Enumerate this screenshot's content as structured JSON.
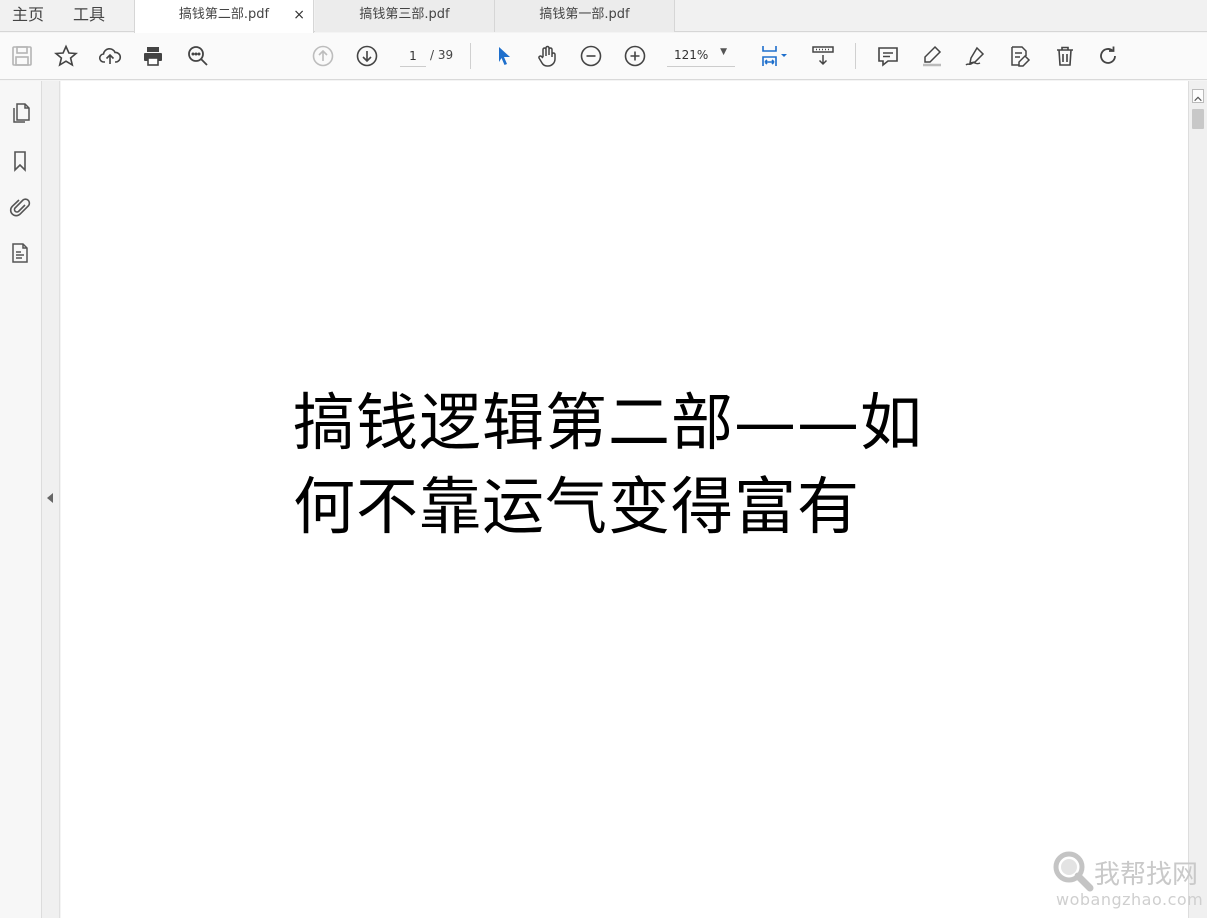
{
  "menu": {
    "home_label": "主页",
    "tools_label": "工具"
  },
  "tabs": [
    {
      "label": "搞钱第二部.pdf",
      "active": true,
      "close": "×"
    },
    {
      "label": "搞钱第三部.pdf",
      "active": false
    },
    {
      "label": "搞钱第一部.pdf",
      "active": false
    }
  ],
  "toolbar": {
    "icons": [
      "save-icon",
      "bookmark-star-icon",
      "upload-cloud-icon",
      "print-icon",
      "zoom-search-icon",
      "prev-page-icon",
      "next-page-icon",
      "select-cursor-icon",
      "hand-pan-icon",
      "zoom-out-icon",
      "zoom-in-icon",
      "fit-page-icon",
      "scroll-mode-icon",
      "comment-icon",
      "highlight-icon",
      "sign-icon",
      "fill-sign-icon",
      "delete-icon",
      "rotate-icon"
    ],
    "current_page": "1",
    "page_total": "/ 39",
    "zoom": "121%",
    "accent_color": "#1e6fcc"
  },
  "left_pane": {
    "icons": [
      "page-thumbnails-icon",
      "bookmarks-icon",
      "attachments-icon",
      "layers-icon"
    ]
  },
  "document": {
    "title_line1": "搞钱逻辑第二部——如",
    "title_line2": "何不靠运气变得富有"
  },
  "watermark": {
    "text": "我帮找网",
    "url": "wobangzhao.com"
  }
}
